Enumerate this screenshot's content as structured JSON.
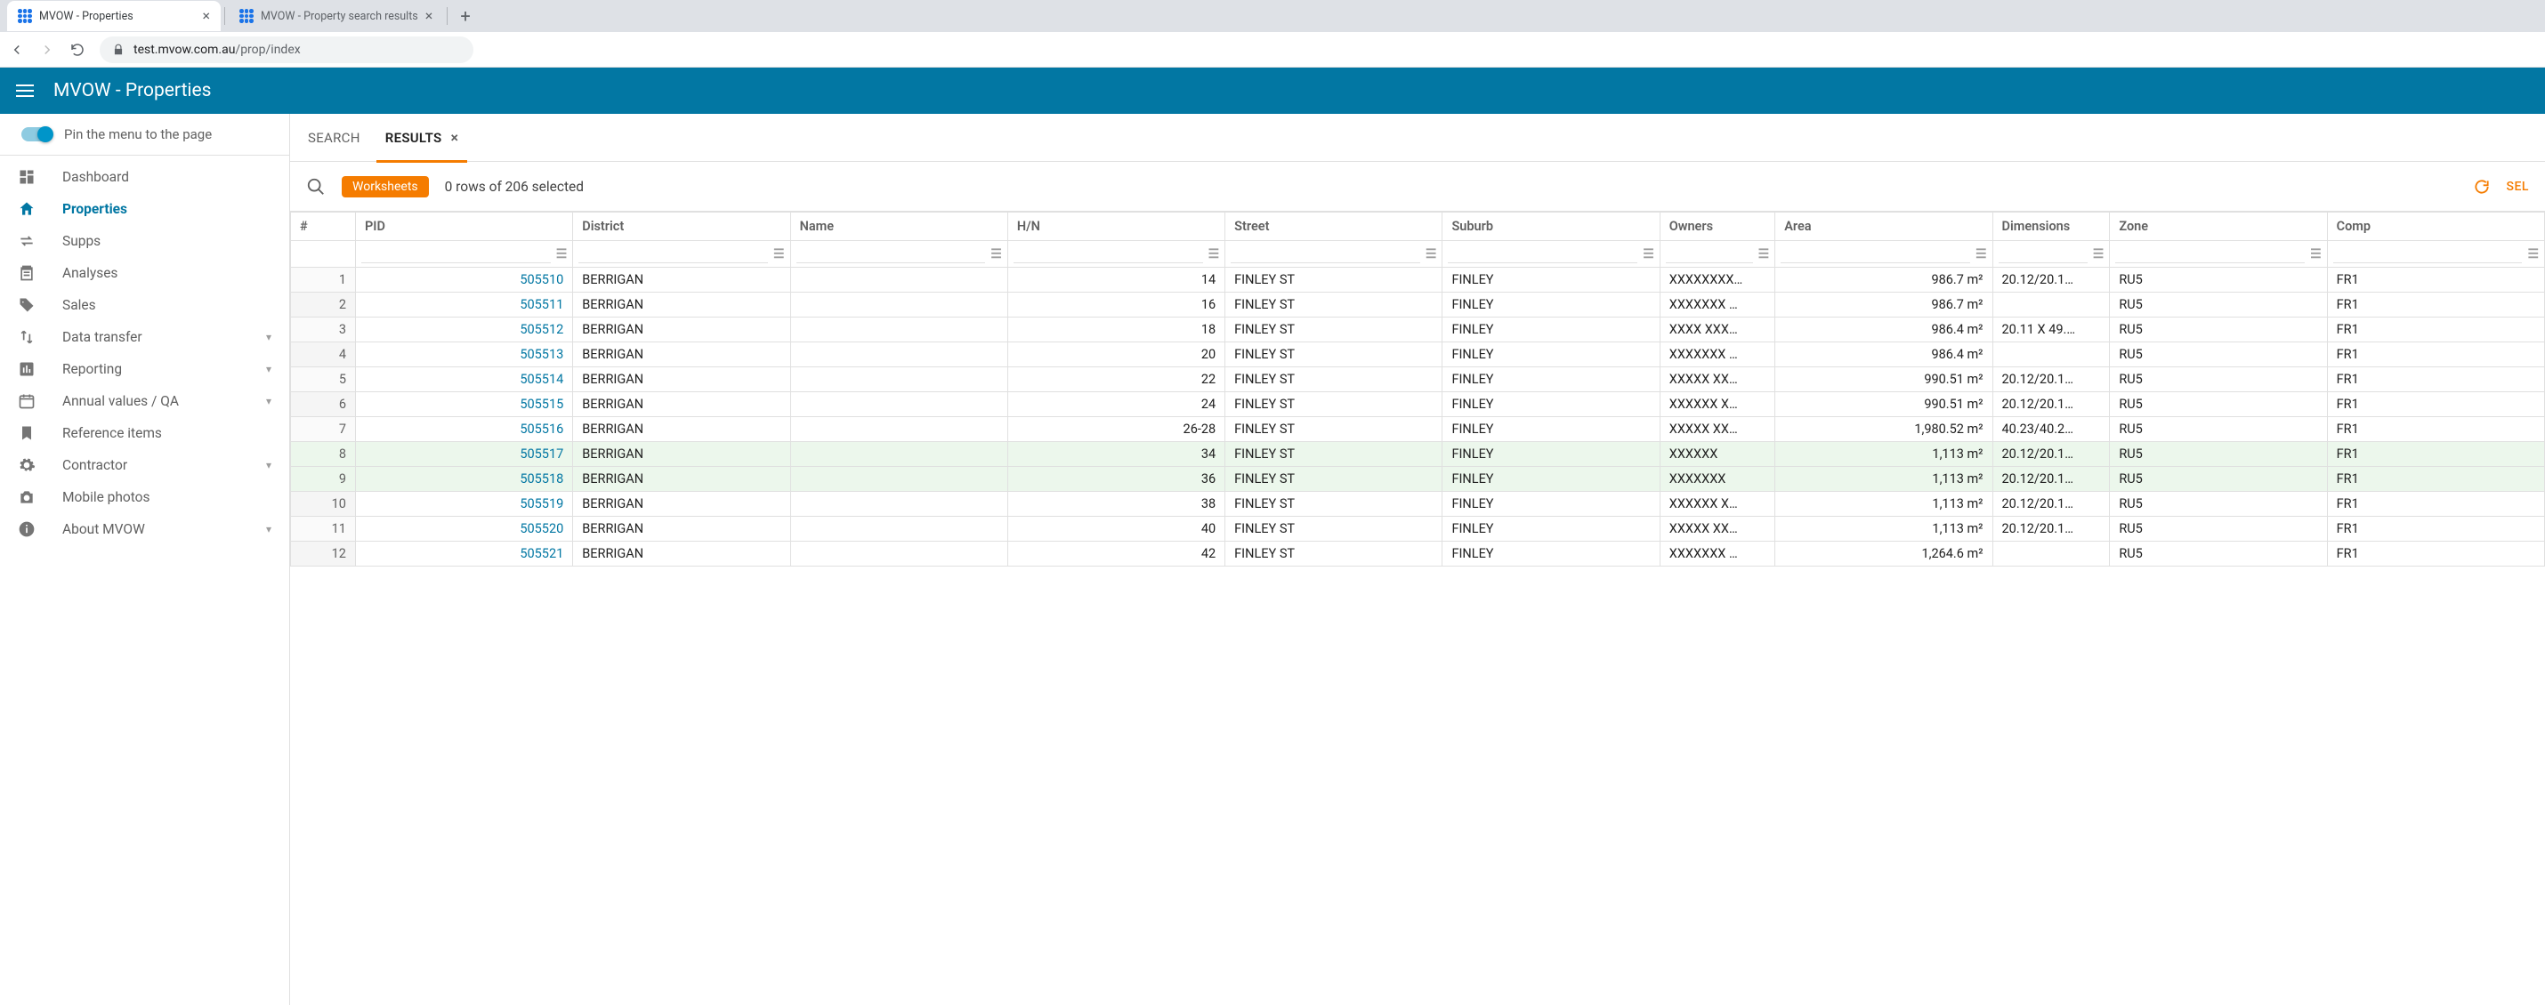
{
  "browser": {
    "tabs": [
      {
        "title": "MVOW - Properties",
        "active": true
      },
      {
        "title": "MVOW - Property search results",
        "active": false
      }
    ],
    "url_host": "test.mvow.com.au",
    "url_path": "/prop/index"
  },
  "header": {
    "title": "MVOW - Properties"
  },
  "sidebar": {
    "pin_label": "Pin the menu to the page",
    "items": [
      {
        "label": "Dashboard",
        "icon": "dashboard",
        "expandable": false
      },
      {
        "label": "Properties",
        "icon": "home",
        "expandable": false,
        "active": true
      },
      {
        "label": "Supps",
        "icon": "swap",
        "expandable": false
      },
      {
        "label": "Analyses",
        "icon": "clipboard",
        "expandable": false
      },
      {
        "label": "Sales",
        "icon": "tag",
        "expandable": false
      },
      {
        "label": "Data transfer",
        "icon": "updown",
        "expandable": true
      },
      {
        "label": "Reporting",
        "icon": "bar",
        "expandable": true
      },
      {
        "label": "Annual values / QA",
        "icon": "calendar",
        "expandable": true
      },
      {
        "label": "Reference items",
        "icon": "bookmark",
        "expandable": false
      },
      {
        "label": "Contractor",
        "icon": "gear",
        "expandable": true
      },
      {
        "label": "Mobile photos",
        "icon": "camera",
        "expandable": false
      },
      {
        "label": "About MVOW",
        "icon": "info",
        "expandable": true
      }
    ]
  },
  "content_tabs": [
    {
      "label": "SEARCH",
      "active": false,
      "closable": false
    },
    {
      "label": "RESULTS",
      "active": true,
      "closable": true
    }
  ],
  "toolbar": {
    "worksheets_label": "Worksheets",
    "selection_info": "0 rows of 206 selected",
    "select_label": "SEL"
  },
  "columns": [
    "#",
    "PID",
    "District",
    "Name",
    "H/N",
    "Street",
    "Suburb",
    "Owners",
    "Area",
    "Dimensions",
    "Zone",
    "Comp"
  ],
  "rows": [
    {
      "idx": 1,
      "pid": "505510",
      "district": "BERRIGAN",
      "name": "",
      "hn": "14",
      "street": "FINLEY ST",
      "suburb": "FINLEY",
      "owners": "XXXXXXXX…",
      "area": "986.7 m²",
      "dim": "20.12/20.1…",
      "zone": "RU5",
      "comp": "FR1",
      "hl": false
    },
    {
      "idx": 2,
      "pid": "505511",
      "district": "BERRIGAN",
      "name": "",
      "hn": "16",
      "street": "FINLEY ST",
      "suburb": "FINLEY",
      "owners": "XXXXXXX …",
      "area": "986.7 m²",
      "dim": "",
      "zone": "RU5",
      "comp": "FR1",
      "hl": false
    },
    {
      "idx": 3,
      "pid": "505512",
      "district": "BERRIGAN",
      "name": "",
      "hn": "18",
      "street": "FINLEY ST",
      "suburb": "FINLEY",
      "owners": "XXXX XXX…",
      "area": "986.4 m²",
      "dim": "20.11 X 49.…",
      "zone": "RU5",
      "comp": "FR1",
      "hl": false
    },
    {
      "idx": 4,
      "pid": "505513",
      "district": "BERRIGAN",
      "name": "",
      "hn": "20",
      "street": "FINLEY ST",
      "suburb": "FINLEY",
      "owners": "XXXXXXX …",
      "area": "986.4 m²",
      "dim": "",
      "zone": "RU5",
      "comp": "FR1",
      "hl": false
    },
    {
      "idx": 5,
      "pid": "505514",
      "district": "BERRIGAN",
      "name": "",
      "hn": "22",
      "street": "FINLEY ST",
      "suburb": "FINLEY",
      "owners": "XXXXX XX…",
      "area": "990.51 m²",
      "dim": "20.12/20.1…",
      "zone": "RU5",
      "comp": "FR1",
      "hl": false
    },
    {
      "idx": 6,
      "pid": "505515",
      "district": "BERRIGAN",
      "name": "",
      "hn": "24",
      "street": "FINLEY ST",
      "suburb": "FINLEY",
      "owners": "XXXXXX X…",
      "area": "990.51 m²",
      "dim": "20.12/20.1…",
      "zone": "RU5",
      "comp": "FR1",
      "hl": false
    },
    {
      "idx": 7,
      "pid": "505516",
      "district": "BERRIGAN",
      "name": "",
      "hn": "26-28",
      "street": "FINLEY ST",
      "suburb": "FINLEY",
      "owners": "XXXXX XX…",
      "area": "1,980.52 m²",
      "dim": "40.23/40.2…",
      "zone": "RU5",
      "comp": "FR1",
      "hl": false
    },
    {
      "idx": 8,
      "pid": "505517",
      "district": "BERRIGAN",
      "name": "",
      "hn": "34",
      "street": "FINLEY ST",
      "suburb": "FINLEY",
      "owners": "XXXXXX",
      "area": "1,113 m²",
      "dim": "20.12/20.1…",
      "zone": "RU5",
      "comp": "FR1",
      "hl": true
    },
    {
      "idx": 9,
      "pid": "505518",
      "district": "BERRIGAN",
      "name": "",
      "hn": "36",
      "street": "FINLEY ST",
      "suburb": "FINLEY",
      "owners": "XXXXXXX",
      "area": "1,113 m²",
      "dim": "20.12/20.1…",
      "zone": "RU5",
      "comp": "FR1",
      "hl": true
    },
    {
      "idx": 10,
      "pid": "505519",
      "district": "BERRIGAN",
      "name": "",
      "hn": "38",
      "street": "FINLEY ST",
      "suburb": "FINLEY",
      "owners": "XXXXXX X…",
      "area": "1,113 m²",
      "dim": "20.12/20.1…",
      "zone": "RU5",
      "comp": "FR1",
      "hl": false
    },
    {
      "idx": 11,
      "pid": "505520",
      "district": "BERRIGAN",
      "name": "",
      "hn": "40",
      "street": "FINLEY ST",
      "suburb": "FINLEY",
      "owners": "XXXXX XX…",
      "area": "1,113 m²",
      "dim": "20.12/20.1…",
      "zone": "RU5",
      "comp": "FR1",
      "hl": false
    },
    {
      "idx": 12,
      "pid": "505521",
      "district": "BERRIGAN",
      "name": "",
      "hn": "42",
      "street": "FINLEY ST",
      "suburb": "FINLEY",
      "owners": "XXXXXXX …",
      "area": "1,264.6 m²",
      "dim": "",
      "zone": "RU5",
      "comp": "FR1",
      "hl": false
    }
  ]
}
